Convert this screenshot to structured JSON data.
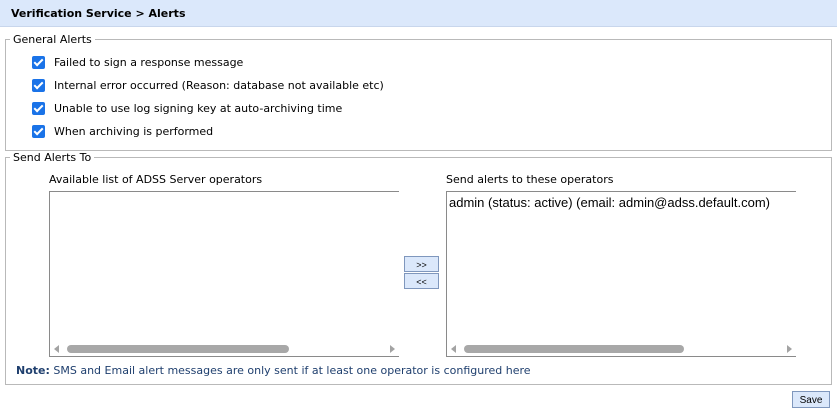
{
  "header": {
    "title": "Verification Service > Alerts"
  },
  "general_alerts": {
    "legend": "General Alerts",
    "items": [
      {
        "label": "Failed to sign a response message",
        "checked": true
      },
      {
        "label": "Internal error occurred (Reason: database not available etc)",
        "checked": true
      },
      {
        "label": "Unable to use log signing key at auto-archiving time",
        "checked": true
      },
      {
        "label": "When archiving is performed",
        "checked": true
      }
    ]
  },
  "send_alerts": {
    "legend": "Send Alerts To",
    "available_label": "Available list of ADSS Server operators",
    "available_items": [],
    "selected_label": "Send alerts to these operators",
    "selected_items": [
      "admin (status: active) (email: admin@adss.default.com)"
    ],
    "add_button": ">>",
    "remove_button": "<<"
  },
  "note": {
    "prefix": "Note:",
    "text": "SMS and Email alert messages are only sent if at least one operator is configured here"
  },
  "footer": {
    "save_label": "Save"
  },
  "colors": {
    "accent": "#1a73e8",
    "header_bg": "#dbe8fb",
    "note_text": "#1f3f6e"
  }
}
